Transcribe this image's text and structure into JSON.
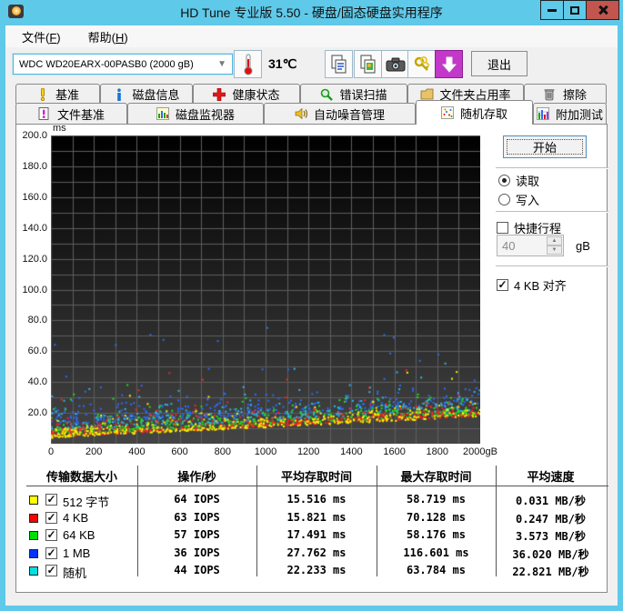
{
  "window": {
    "title": "HD Tune 专业版 5.50 - 硬盘/固态硬盘实用程序"
  },
  "menu": {
    "items": [
      {
        "pre": "文件(",
        "key": "F",
        "post": ")"
      },
      {
        "pre": "帮助(",
        "key": "H",
        "post": ")"
      }
    ]
  },
  "toolbar": {
    "drive": "WDC WD20EARX-00PASB0 (2000 gB)",
    "temperature": "31℃",
    "exit_label": "退出"
  },
  "tabs": {
    "selected": "随机存取",
    "row1": [
      {
        "label": "基准",
        "icon": "benchmark-icon"
      },
      {
        "label": "磁盘信息",
        "icon": "disk-info-icon"
      },
      {
        "label": "健康状态",
        "icon": "health-icon"
      },
      {
        "label": "错误扫描",
        "icon": "error-scan-icon"
      },
      {
        "label": "文件夹占用率",
        "icon": "folder-usage-icon"
      },
      {
        "label": "擦除",
        "icon": "erase-icon"
      }
    ],
    "row2": [
      {
        "label": "文件基准",
        "icon": "file-benchmark-icon"
      },
      {
        "label": "磁盘监视器",
        "icon": "disk-monitor-icon"
      },
      {
        "label": "自动噪音管理",
        "icon": "aam-icon"
      },
      {
        "label": "随机存取",
        "icon": "random-access-icon",
        "selected": true
      },
      {
        "label": "附加测试",
        "icon": "extra-tests-icon"
      }
    ]
  },
  "panel": {
    "start_label": "开始",
    "read_label": "读取",
    "read_selected": true,
    "write_label": "写入",
    "write_selected": false,
    "short_stroke_label": "快捷行程",
    "short_stroke_checked": false,
    "short_stroke_value": "40",
    "short_stroke_unit": "gB",
    "align_label": "4 KB 对齐",
    "align_checked": true,
    "check_glyph": "✓"
  },
  "table": {
    "headers": [
      "传输数据大小",
      "操作/秒",
      "平均存取时间",
      "最大存取时间",
      "平均速度"
    ],
    "rows": [
      {
        "color": "#ffff00",
        "label": "512 字节",
        "checked": true,
        "iops": "64 IOPS",
        "avg": "15.516 ms",
        "max": "58.719 ms",
        "speed": "0.031 MB/秒"
      },
      {
        "color": "#ff0000",
        "label": "4 KB",
        "checked": true,
        "iops": "63 IOPS",
        "avg": "15.821 ms",
        "max": "70.128 ms",
        "speed": "0.247 MB/秒"
      },
      {
        "color": "#00e000",
        "label": "64 KB",
        "checked": true,
        "iops": "57 IOPS",
        "avg": "17.491 ms",
        "max": "58.176 ms",
        "speed": "3.573 MB/秒"
      },
      {
        "color": "#0033ff",
        "label": "1 MB",
        "checked": true,
        "iops": "36 IOPS",
        "avg": "27.762 ms",
        "max": "116.601 ms",
        "speed": "36.020 MB/秒"
      },
      {
        "color": "#00e0e0",
        "label": "随机",
        "checked": true,
        "iops": "44 IOPS",
        "avg": "22.233 ms",
        "max": "63.784 ms",
        "speed": "22.821 MB/秒"
      }
    ]
  },
  "chart_data": {
    "type": "scatter",
    "title": "随机存取 - 存取时间 vs 磁盘位置",
    "ylabel": "ms",
    "x_unit": "gB",
    "x_range": [
      0,
      2000
    ],
    "y_range": [
      0,
      200
    ],
    "x_tick_step": 200,
    "y_tick_step": 20,
    "grid_x_step": 100,
    "grid_y_step": 10,
    "grid": true,
    "background_gradient": [
      "#000000",
      "#454545"
    ],
    "grid_color": "#5e5e5e",
    "seed": 20,
    "floor_ms": {
      "start": 3.5,
      "end": 17
    },
    "draw_order": [
      3,
      4,
      2,
      1,
      0
    ],
    "series": [
      {
        "name": "512 字节",
        "dot_color": "#ffee00",
        "count": 430,
        "offset": 0.3,
        "spread": 6.5,
        "outlier_rate": 0.025,
        "outlier_spread": 28,
        "stats": {
          "iops": 64,
          "avg_ms": 15.516,
          "max_ms": 58.719,
          "speed_MB_s": 0.031
        }
      },
      {
        "name": "4 KB",
        "dot_color": "#ff2222",
        "count": 430,
        "offset": 0.8,
        "spread": 7,
        "outlier_rate": 0.025,
        "outlier_spread": 35,
        "stats": {
          "iops": 63,
          "avg_ms": 15.821,
          "max_ms": 70.128,
          "speed_MB_s": 0.247
        }
      },
      {
        "name": "64 KB",
        "dot_color": "#22dd22",
        "count": 420,
        "offset": 2,
        "spread": 8,
        "outlier_rate": 0.03,
        "outlier_spread": 30,
        "stats": {
          "iops": 57,
          "avg_ms": 17.491,
          "max_ms": 58.176,
          "speed_MB_s": 3.573
        }
      },
      {
        "name": "1 MB",
        "dot_color": "#2a6cff",
        "count": 330,
        "offset": 8.5,
        "spread": 11,
        "outlier_rate": 0.05,
        "outlier_spread": 55,
        "stats": {
          "iops": 36,
          "avg_ms": 27.762,
          "max_ms": 116.601,
          "speed_MB_s": 36.02
        }
      },
      {
        "name": "随机",
        "dot_color": "#2fb9e8",
        "count": 330,
        "offset": 4.5,
        "spread": 10,
        "outlier_rate": 0.04,
        "outlier_spread": 30,
        "stats": {
          "iops": 44,
          "avg_ms": 22.233,
          "max_ms": 63.784,
          "speed_MB_s": 22.821
        }
      }
    ]
  }
}
